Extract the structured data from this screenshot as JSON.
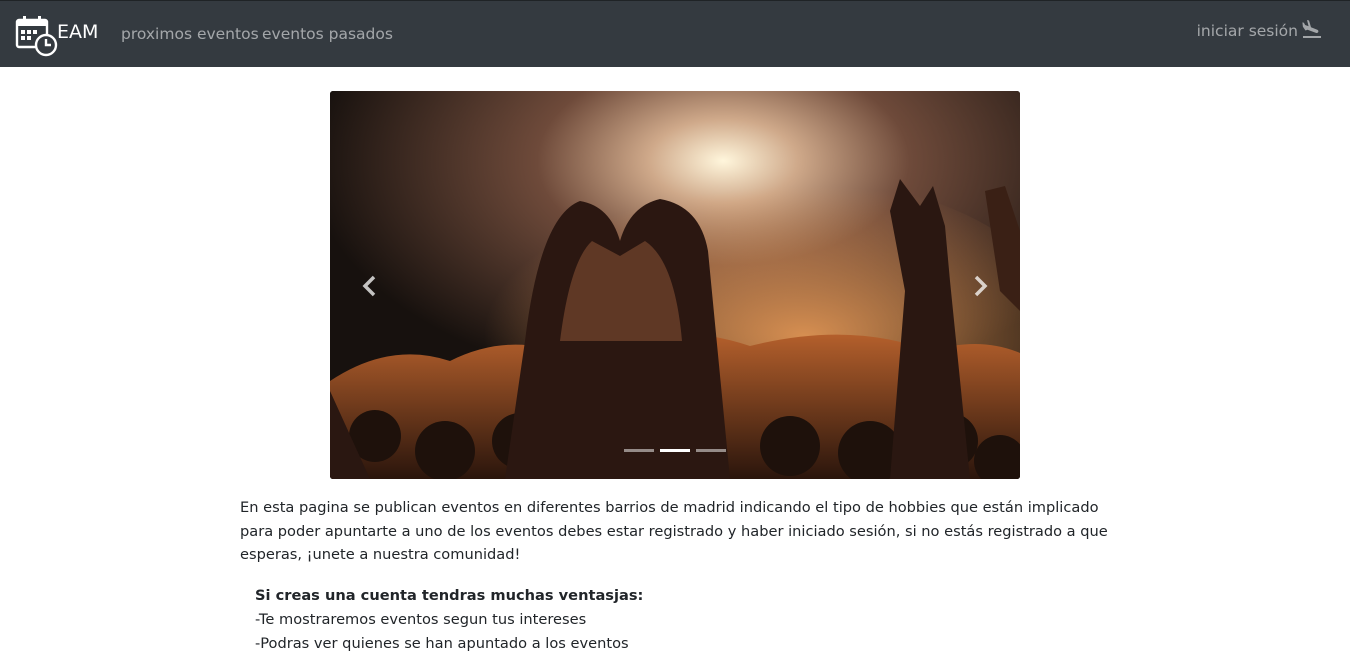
{
  "navbar": {
    "brand": "EAM",
    "links": [
      "proximos eventos",
      "eventos pasados"
    ],
    "login_label": "iniciar sesión"
  },
  "carousel": {
    "slides": 3,
    "active_slide": 2,
    "icons": {
      "prev": "chevron-left-icon",
      "next": "chevron-right-icon"
    }
  },
  "content": {
    "intro": "En esta pagina se publican eventos en diferentes barrios de madrid indicando el tipo de hobbies que están implicado para poder apuntarte a uno de los eventos debes estar registrado y haber iniciado sesión, si no estás registrado a que esperas, ¡unete a nuestra comunidad!",
    "benefits_title": "Si creas una cuenta tendras muchas ventasjas:",
    "benefits": [
      "-Te mostraremos eventos segun tus intereses",
      "-Podras ver quienes se han apuntado a los eventos"
    ]
  },
  "colors": {
    "navbar": "#343a40",
    "nav_text": "rgba(255,255,255,0.55)"
  }
}
